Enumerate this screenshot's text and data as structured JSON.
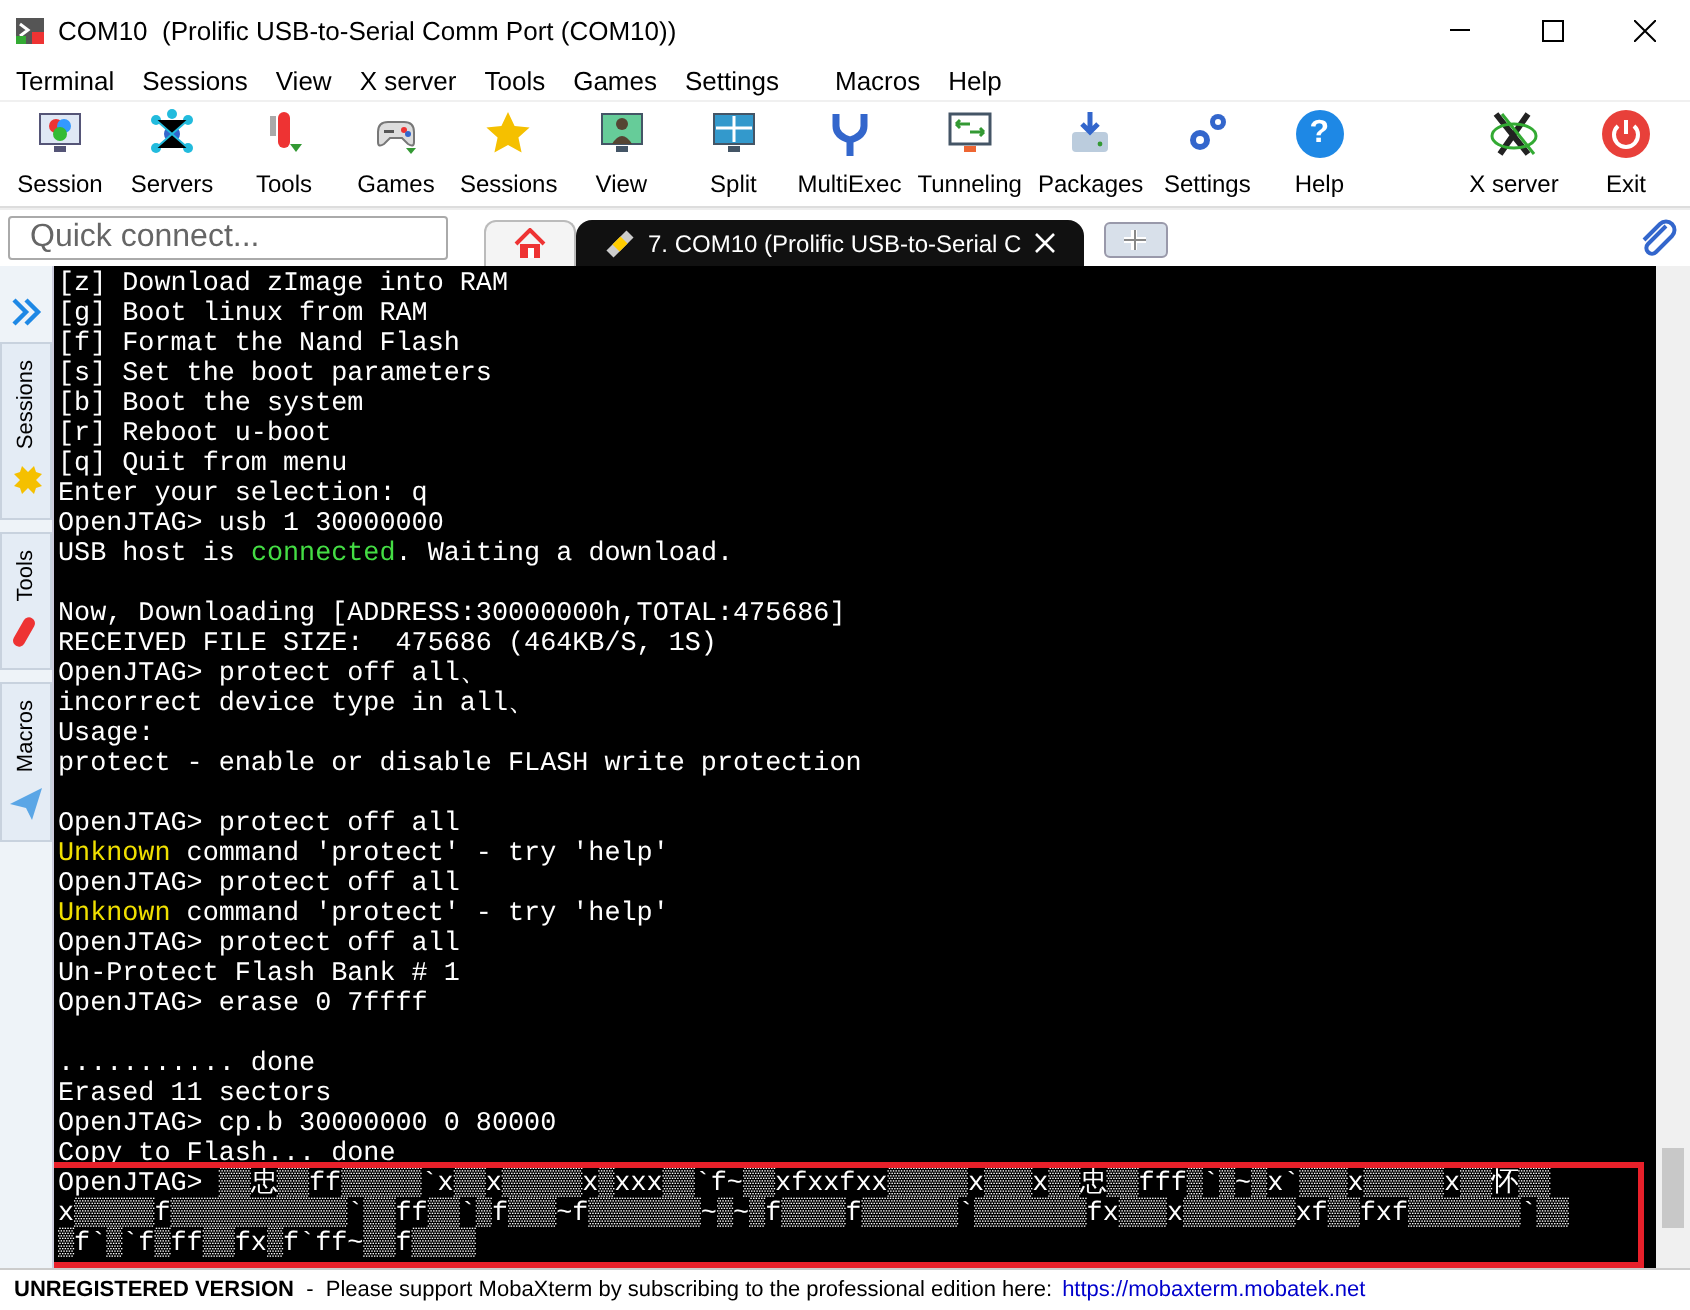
{
  "window": {
    "title": "COM10  (Prolific USB-to-Serial Comm Port (COM10))"
  },
  "menu": [
    "Terminal",
    "Sessions",
    "View",
    "X server",
    "Tools",
    "Games",
    "Settings",
    "Macros",
    "Help"
  ],
  "toolbar": {
    "left": [
      {
        "label": "Session"
      },
      {
        "label": "Servers"
      },
      {
        "label": "Tools"
      },
      {
        "label": "Games"
      },
      {
        "label": "Sessions"
      },
      {
        "label": "View"
      },
      {
        "label": "Split"
      },
      {
        "label": "MultiExec"
      },
      {
        "label": "Tunneling"
      },
      {
        "label": "Packages"
      },
      {
        "label": "Settings"
      },
      {
        "label": "Help",
        "glyph": "?"
      }
    ],
    "right": [
      {
        "label": "X server"
      },
      {
        "label": "Exit"
      }
    ]
  },
  "quick_connect": {
    "placeholder": "Quick connect..."
  },
  "tabs": [
    {
      "kind": "home",
      "selected": false
    },
    {
      "kind": "session",
      "label": "7. COM10 (Prolific USB-to-Serial C",
      "selected": true
    },
    {
      "kind": "new",
      "selected": false
    }
  ],
  "sidebar": [
    "Sessions",
    "Tools",
    "Macros"
  ],
  "terminal": {
    "lines": [
      {
        "kind": "text",
        "segments": [
          {
            "text": "[z] Download zImage into RAM",
            "kind": "plain"
          }
        ]
      },
      {
        "kind": "text",
        "segments": [
          {
            "text": "[g] Boot linux from RAM",
            "kind": "plain"
          }
        ]
      },
      {
        "kind": "text",
        "segments": [
          {
            "text": "[f] Format the Nand Flash",
            "kind": "plain"
          }
        ]
      },
      {
        "kind": "text",
        "segments": [
          {
            "text": "[s] Set the boot parameters",
            "kind": "plain"
          }
        ]
      },
      {
        "kind": "text",
        "segments": [
          {
            "text": "[b] Boot the system",
            "kind": "plain"
          }
        ]
      },
      {
        "kind": "text",
        "segments": [
          {
            "text": "[r] Reboot u-boot",
            "kind": "plain"
          }
        ]
      },
      {
        "kind": "text",
        "segments": [
          {
            "text": "[q] Quit from menu",
            "kind": "plain"
          }
        ]
      },
      {
        "kind": "text",
        "segments": [
          {
            "text": "Enter your selection: q",
            "kind": "plain"
          }
        ]
      },
      {
        "kind": "text",
        "segments": [
          {
            "text": "OpenJTAG> usb 1 30000000",
            "kind": "plain"
          }
        ]
      },
      {
        "kind": "text",
        "segments": [
          {
            "text": "USB host is ",
            "kind": "plain"
          },
          {
            "text": "connected",
            "kind": "ok"
          },
          {
            "text": ". Waiting a download.",
            "kind": "plain"
          }
        ]
      },
      {
        "kind": "blank"
      },
      {
        "kind": "text",
        "segments": [
          {
            "text": "Now, Downloading [ADDRESS:30000000h,TOTAL:475686]",
            "kind": "plain"
          }
        ]
      },
      {
        "kind": "text",
        "segments": [
          {
            "text": "RECEIVED FILE SIZE:  475686 (464KB/S, 1S)",
            "kind": "plain"
          }
        ]
      },
      {
        "kind": "text",
        "segments": [
          {
            "text": "OpenJTAG> protect off all、",
            "kind": "plain"
          }
        ]
      },
      {
        "kind": "text",
        "segments": [
          {
            "text": "incorrect device type in all、",
            "kind": "plain"
          }
        ]
      },
      {
        "kind": "text",
        "segments": [
          {
            "text": "Usage:",
            "kind": "plain"
          }
        ]
      },
      {
        "kind": "text",
        "segments": [
          {
            "text": "protect - enable or disable FLASH write protection",
            "kind": "plain"
          }
        ]
      },
      {
        "kind": "blank"
      },
      {
        "kind": "text",
        "segments": [
          {
            "text": "OpenJTAG> protect off all",
            "kind": "plain"
          }
        ]
      },
      {
        "kind": "text",
        "segments": [
          {
            "text": "Unknown",
            "kind": "warn"
          },
          {
            "text": " command 'protect' - try 'help'",
            "kind": "plain"
          }
        ]
      },
      {
        "kind": "text",
        "segments": [
          {
            "text": "OpenJTAG> protect off all",
            "kind": "plain"
          }
        ]
      },
      {
        "kind": "text",
        "segments": [
          {
            "text": "Unknown",
            "kind": "warn"
          },
          {
            "text": " command 'protect' - try 'help'",
            "kind": "plain"
          }
        ]
      },
      {
        "kind": "text",
        "segments": [
          {
            "text": "OpenJTAG> protect off all",
            "kind": "plain"
          }
        ]
      },
      {
        "kind": "text",
        "segments": [
          {
            "text": "Un-Protect Flash Bank # 1",
            "kind": "plain"
          }
        ]
      },
      {
        "kind": "text",
        "segments": [
          {
            "text": "OpenJTAG> erase 0 7ffff",
            "kind": "plain"
          }
        ]
      },
      {
        "kind": "blank"
      },
      {
        "kind": "text",
        "segments": [
          {
            "text": "........... done",
            "kind": "plain"
          }
        ]
      },
      {
        "kind": "text",
        "segments": [
          {
            "text": "Erased 11 sectors",
            "kind": "plain"
          }
        ]
      },
      {
        "kind": "text",
        "segments": [
          {
            "text": "OpenJTAG> cp.b 30000000 0 80000",
            "kind": "plain"
          }
        ]
      },
      {
        "kind": "text",
        "segments": [
          {
            "text": "Copy to Flash... done",
            "kind": "plain"
          }
        ]
      },
      {
        "kind": "text",
        "highlighted": true,
        "segments": [
          {
            "text": "OpenJTAG> ▒▒忠▒▒ff▒▒▒▒▒`x▒▒x▒▒▒▒▒x▒xxx▒▒`f~▒▒xfxxfxx▒▒▒▒▒x▒▒▒x▒▒忠▒▒fff▒`▒~▒x`▒▒▒x▒▒▒▒▒x▒▒怀▒▒",
            "kind": "plain"
          }
        ]
      },
      {
        "kind": "text",
        "highlighted": true,
        "segments": [
          {
            "text": "x▒▒▒▒▒f▒▒▒▒▒▒▒▒▒▒▒`▒▒ff▒▒`▒f▒▒▒~f▒▒▒▒▒▒▒~▒~▒f▒▒▒▒f▒▒▒▒▒▒`▒▒▒▒▒▒▒fx▒▒▒x▒▒▒▒▒▒▒xf▒▒fxf▒▒▒▒▒▒▒`▒▒",
            "kind": "plain"
          }
        ]
      },
      {
        "kind": "text",
        "highlighted": true,
        "segments": [
          {
            "text": "▒f`▒`f▒ff▒▒fx▒f`ff~▒▒f▒▒▒▒",
            "kind": "plain"
          }
        ]
      }
    ]
  },
  "status": {
    "message": "**UNREGISTERED VERSION**  -  Please support MobaXterm by subscribing to the professional edition here:",
    "link": "https://mobaxterm.mobatek.net"
  }
}
